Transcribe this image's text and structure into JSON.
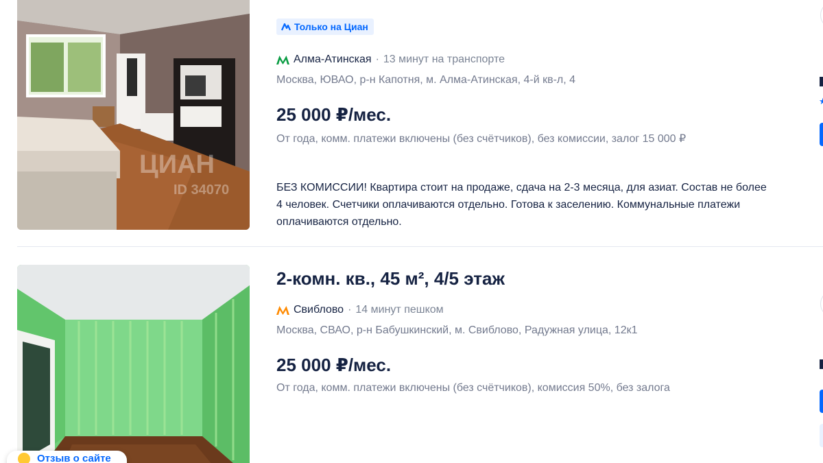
{
  "listings": [
    {
      "badge": "Только на Циан",
      "metro": {
        "station": "Алма-Атинская",
        "separator": "·",
        "time": "13 минут на транспорте",
        "color": "#0a9c43"
      },
      "address": "Москва, ЮВАО, р-н Капотня, м. Алма-Атинская, 4-й кв-л, 4",
      "price": "25 000 ₽/мес.",
      "terms": "От года, комм. платежи включены (без счётчиков), без комиссии, залог 15 000 ₽",
      "description": "БЕЗ КОМИССИИ! Квартира стоит на продаже, сдача на 2-3 месяца, для азиат. Состав не более 4 человек. Счетчики оплачиваются отдельно. Готова к заселению. Коммунальные платежи оплачиваются отдельно.",
      "watermark": "ЦИАН",
      "watermark_id": "ID 34070"
    },
    {
      "title": "2-комн. кв., 45 м², 4/5 этаж",
      "metro": {
        "station": "Свиблово",
        "separator": "·",
        "time": "14 минут пешком",
        "color": "#ff8a00"
      },
      "address": "Москва, СВАО, р-н Бабушкинский, м. Свиблово, Радужная улица, 12к1",
      "price": "25 000 ₽/мес.",
      "terms": "От года, комм. платежи включены (без счётчиков), комиссия 50%, без залога"
    }
  ],
  "chat_chip": {
    "label": "Отзыв о сайте",
    "icon": "smile-emoji-icon"
  },
  "colors": {
    "accent": "#0468ff",
    "text": "#152242",
    "muted": "#737a8e",
    "badge_bg": "#e9f1ff"
  }
}
